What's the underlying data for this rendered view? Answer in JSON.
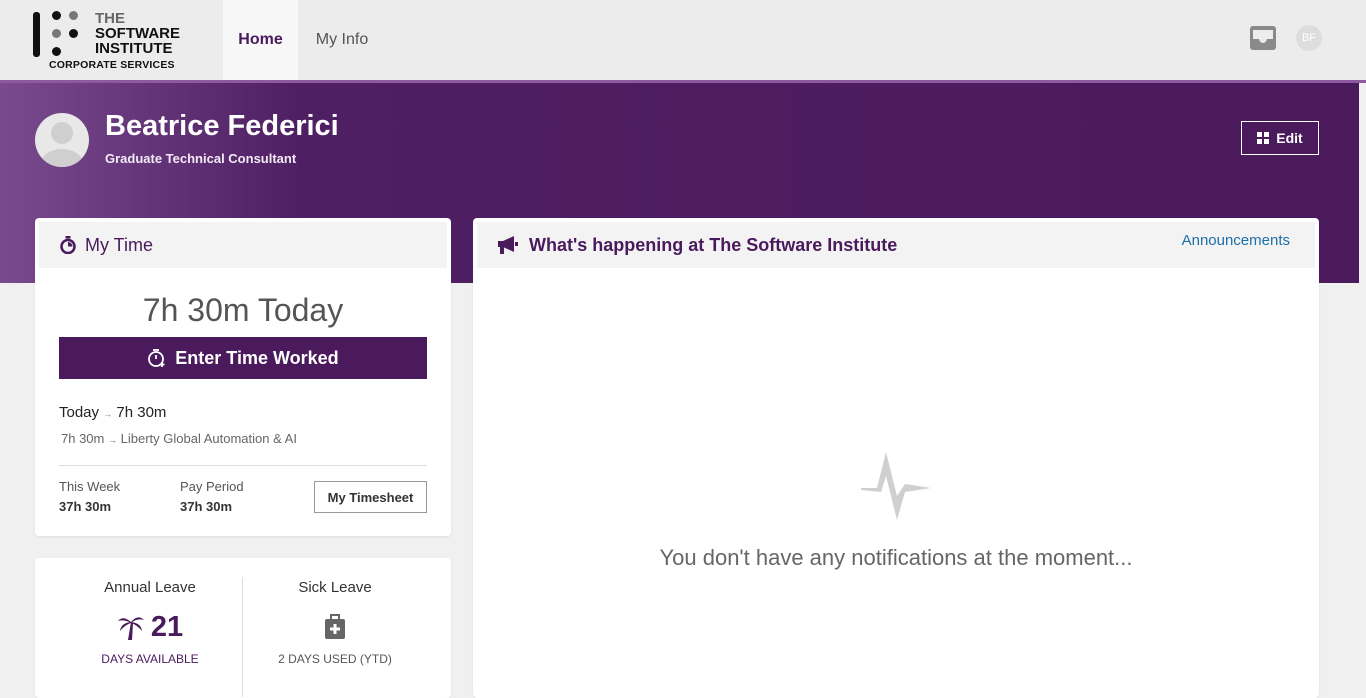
{
  "header": {
    "logo": {
      "line1": "THE",
      "line2": "SOFTWARE",
      "line3": "INSTITUTE",
      "line4": "CORPORATE SERVICES"
    },
    "nav": {
      "home": "Home",
      "my_info": "My Info"
    },
    "user_initials": "BF"
  },
  "profile": {
    "name": "Beatrice Federici",
    "job_title": "Graduate Technical Consultant",
    "edit_label": "Edit"
  },
  "my_time": {
    "title": "My Time",
    "today_total": "7h 30m Today",
    "enter_button": "Enter Time Worked",
    "today_label": "Today",
    "today_value": "7h 30m",
    "entry_hours": "7h 30m",
    "entry_project": "Liberty Global Automation & AI",
    "this_week_label": "This Week",
    "this_week_value": "37h 30m",
    "pay_period_label": "Pay Period",
    "pay_period_value": "37h 30m",
    "timesheet_button": "My Timesheet"
  },
  "leave": {
    "annual": {
      "label": "Annual Leave",
      "value": "21",
      "footer": "DAYS AVAILABLE"
    },
    "sick": {
      "label": "Sick Leave",
      "footer": "2 DAYS USED (YTD)"
    }
  },
  "news": {
    "title": "What's happening at The Software Institute",
    "link": "Announcements",
    "empty_message": "You don't have any notifications at the moment..."
  },
  "colors": {
    "brand_purple": "#4a1a5c",
    "link_blue": "#1d6fa8",
    "nav_accent": "#8e5a9f"
  }
}
